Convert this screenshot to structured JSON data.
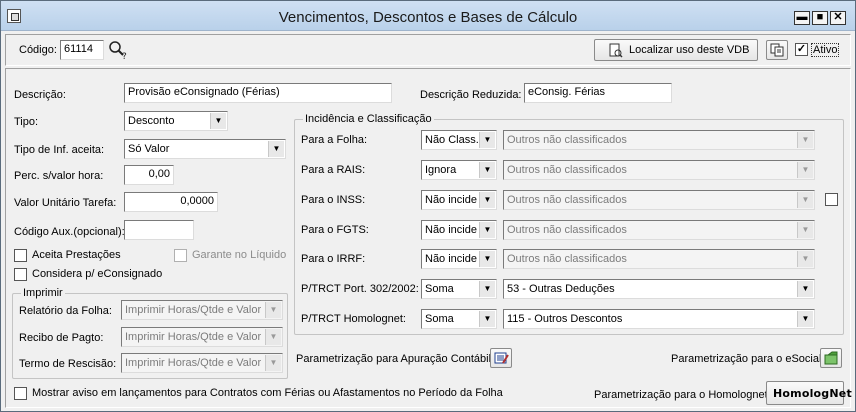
{
  "window": {
    "title": "Vencimentos, Descontos e Bases de Cálculo",
    "minimize": "▬",
    "maximize": "■",
    "close": "✕"
  },
  "toolbar": {
    "codigo_label": "Código:",
    "codigo_value": "61114",
    "localizar_label": "Localizar uso deste VDB",
    "ativo_label": "Ativo",
    "ativo_checked": "✓"
  },
  "form": {
    "descricao_label": "Descrição:",
    "descricao_value": "Provisão eConsignado (Férias)",
    "desc_reduzida_label": "Descrição Reduzida:",
    "desc_reduzida_value": "eConsig. Férias",
    "tipo_label": "Tipo:",
    "tipo_value": "Desconto",
    "tipo_inf_label": "Tipo de Inf. aceita:",
    "tipo_inf_value": "Só Valor",
    "perc_label": "Perc. s/valor hora:",
    "perc_value": "0,00",
    "valor_unit_label": "Valor Unitário Tarefa:",
    "valor_unit_value": "0,0000",
    "cod_aux_label": "Código Aux.(opcional):",
    "cod_aux_value": "",
    "aceita_label": "Aceita Prestações",
    "garante_label": "Garante no Líquido",
    "considera_label": "Considera p/ eConsignado"
  },
  "imprimir": {
    "title": "Imprimir",
    "rows": [
      {
        "label": "Relatório da Folha:",
        "value": "Imprimir Horas/Qtde e Valor"
      },
      {
        "label": "Recibo de Pagto:",
        "value": "Imprimir Horas/Qtde e Valor"
      },
      {
        "label": "Termo de Rescisão:",
        "value": "Imprimir Horas/Qtde e Valor"
      }
    ]
  },
  "incidencia": {
    "title": "Incidência e Classificação",
    "rows": [
      {
        "label": "Para a Folha:",
        "short": "Não Class.",
        "long": "Outros não classificados"
      },
      {
        "label": "Para a RAIS:",
        "short": "Ignora",
        "long": "Outros não classificados"
      },
      {
        "label": "Para o INSS:",
        "short": "Não incide",
        "long": "Outros não classificados"
      },
      {
        "label": "Para o FGTS:",
        "short": "Não incide",
        "long": "Outros não classificados"
      },
      {
        "label": "Para o IRRF:",
        "short": "Não incide",
        "long": "Outros não classificados"
      },
      {
        "label": "P/TRCT Port. 302/2002:",
        "short": "Soma",
        "long": "53 - Outras Deduções"
      },
      {
        "label": "P/TRCT Homolognet:",
        "short": "Soma",
        "long": "115 - Outros Descontos"
      }
    ]
  },
  "bottom": {
    "param_contabil_label": "Parametrização para Apuração Contábil:",
    "param_esocial_label": "Parametrização para o eSocial:",
    "param_homolognet_label": "Parametrização para o Homolognet:",
    "homolognet_logo": "HomologNet",
    "mostrar_aviso_label": "Mostrar aviso em lançamentos para Contratos com Férias ou Afastamentos no Período da Folha"
  }
}
